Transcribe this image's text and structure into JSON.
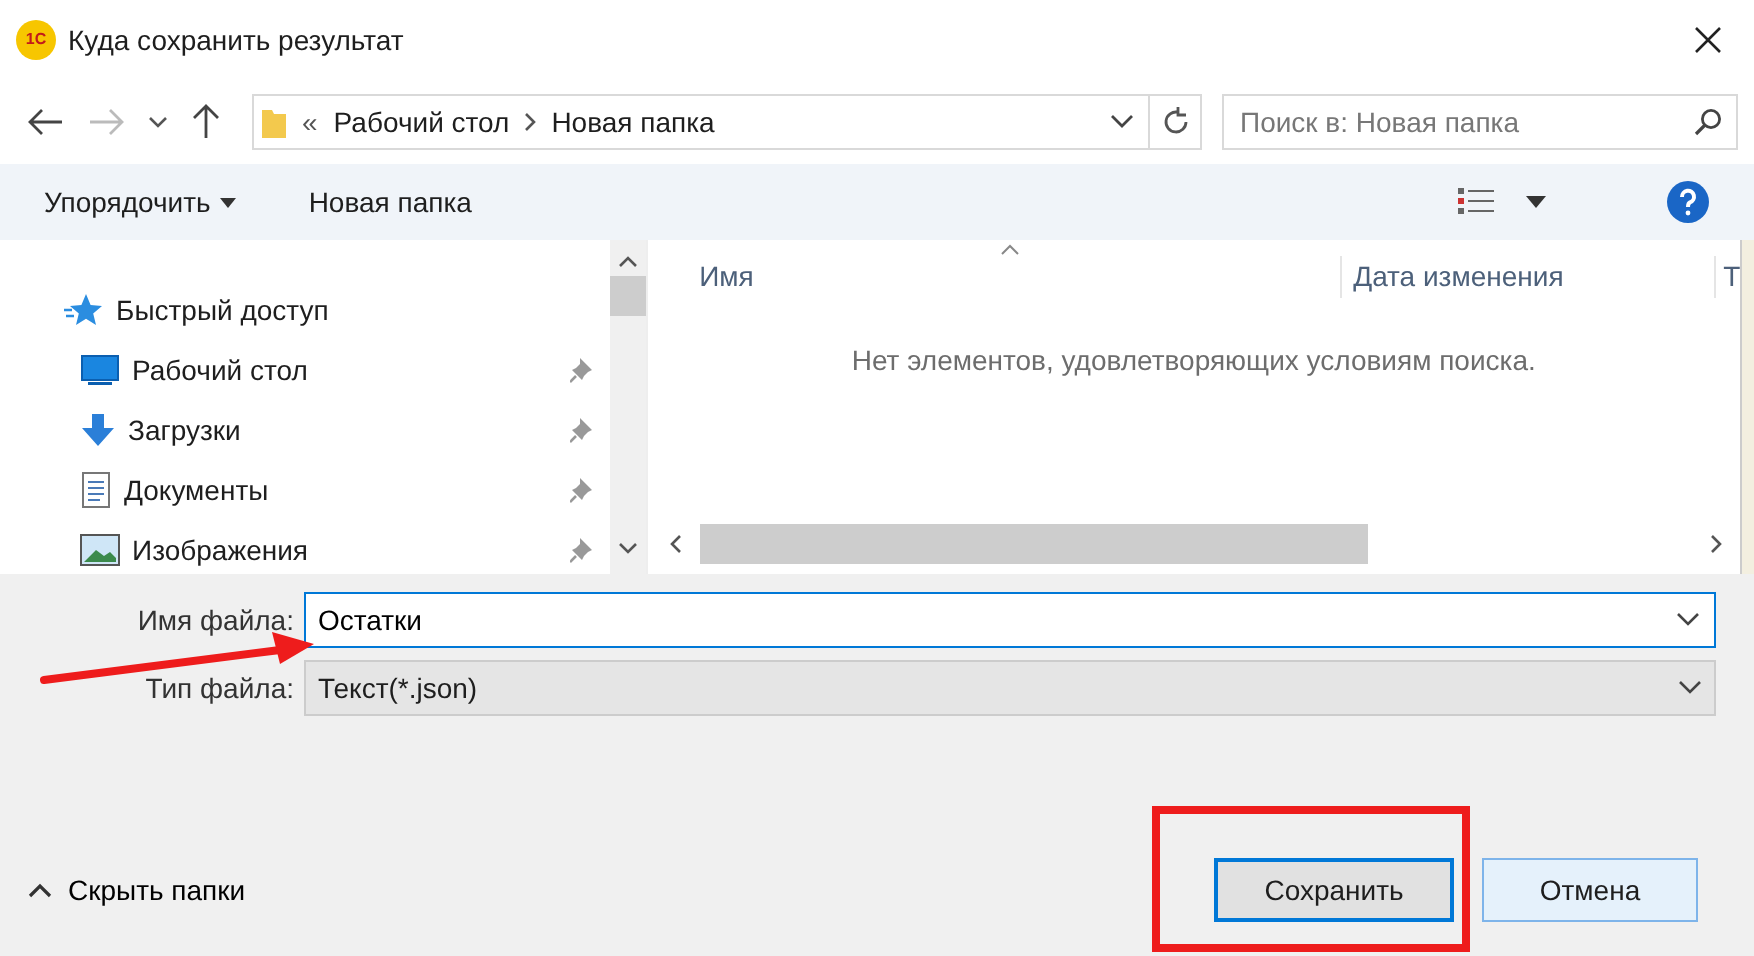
{
  "window": {
    "logo": "1С",
    "title": "Куда сохранить результат"
  },
  "address_bar": {
    "overflow": "«",
    "path": [
      "Рабочий стол",
      "Новая папка"
    ],
    "search_placeholder": "Поиск в: Новая папка"
  },
  "toolbar": {
    "organize": "Упорядочить",
    "new_folder": "Новая папка"
  },
  "navigation": {
    "items": [
      {
        "kind": "star",
        "label": "Быстрый доступ",
        "pinned": false
      },
      {
        "kind": "desktop",
        "label": "Рабочий стол",
        "pinned": true
      },
      {
        "kind": "download",
        "label": "Загрузки",
        "pinned": true
      },
      {
        "kind": "document",
        "label": "Документы",
        "pinned": true
      },
      {
        "kind": "image",
        "label": "Изображения",
        "pinned": true
      }
    ]
  },
  "file_list": {
    "columns": [
      "Имя",
      "Дата изменения"
    ],
    "column_3": "Т",
    "empty_message": "Нет элементов, удовлетворяющих условиям поиска."
  },
  "form": {
    "file_name_label": "Имя файла:",
    "file_name": "Остатки",
    "file_type_label": "Тип файла:",
    "file_type": "Текст(*.json)"
  },
  "footer": {
    "hide_folders": "Скрыть папки",
    "buttons": [
      {
        "label": "Сохранить",
        "default": true
      },
      {
        "label": "Отмена",
        "default": false
      }
    ]
  },
  "annotations": {
    "arrow": true,
    "frame": true
  }
}
